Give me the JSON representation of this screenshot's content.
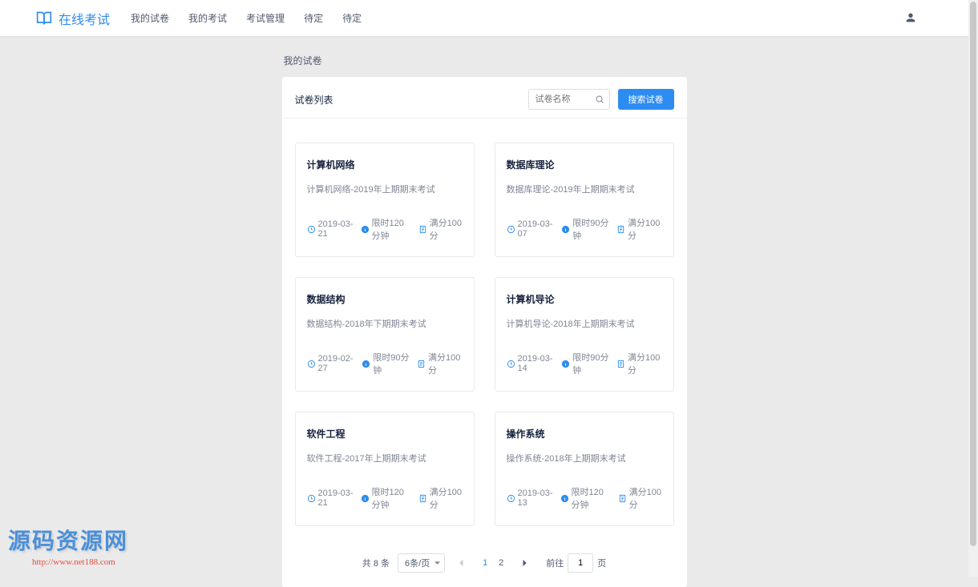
{
  "header": {
    "logo_text": "在线考试",
    "nav": [
      "我的试卷",
      "我的考试",
      "考试管理",
      "待定",
      "待定"
    ]
  },
  "breadcrumb": "我的试卷",
  "panel": {
    "title": "试卷列表",
    "search_placeholder": "试卷名称",
    "search_button": "搜索试卷"
  },
  "cards": [
    {
      "title": "计算机网络",
      "sub": "计算机网络-2019年上期期末考试",
      "date": "2019-03-21",
      "limit": "限时120分钟",
      "score": "满分100分"
    },
    {
      "title": "数据库理论",
      "sub": "数据库理论-2019年上期期末考试",
      "date": "2019-03-07",
      "limit": "限时90分钟",
      "score": "满分100分"
    },
    {
      "title": "数据结构",
      "sub": "数据结构-2018年下期期末考试",
      "date": "2019-02-27",
      "limit": "限时90分钟",
      "score": "满分100分"
    },
    {
      "title": "计算机导论",
      "sub": "计算机导论-2018年上期期末考试",
      "date": "2019-03-14",
      "limit": "限时90分钟",
      "score": "满分100分"
    },
    {
      "title": "软件工程",
      "sub": "软件工程-2017年上期期末考试",
      "date": "2019-03-21",
      "limit": "限时120分钟",
      "score": "满分100分"
    },
    {
      "title": "操作系统",
      "sub": "操作系统-2018年上期期末考试",
      "date": "2019-03-13",
      "limit": "限时120分钟",
      "score": "满分100分"
    }
  ],
  "pagination": {
    "total_label": "共 8 条",
    "per_page": "6条/页",
    "current": "1",
    "pages": [
      "1",
      "2"
    ],
    "goto_prefix": "前往",
    "goto_value": "1",
    "goto_suffix": "页"
  },
  "watermark": {
    "text": "源码资源网",
    "url": "http://www.net188.com"
  }
}
